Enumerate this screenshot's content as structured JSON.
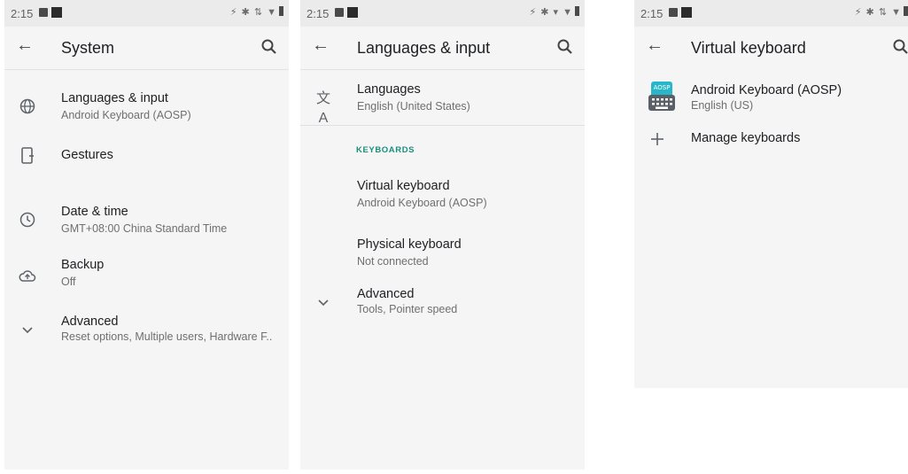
{
  "statusbar": {
    "time": "2:15"
  },
  "screen1": {
    "title": "System",
    "items": [
      {
        "icon": "globe-icon",
        "title": "Languages & input",
        "subtitle": "Android Keyboard (AOSP)"
      },
      {
        "icon": "gestures-icon",
        "title": "Gestures",
        "subtitle": ""
      },
      {
        "icon": "clock-icon",
        "title": "Date & time",
        "subtitle": "GMT+08:00 China Standard Time"
      },
      {
        "icon": "cloud-backup-icon",
        "title": "Backup",
        "subtitle": "Off"
      },
      {
        "icon": "chevron-down-icon",
        "title": "Advanced",
        "subtitle": "Reset options, Multiple users, Hardware F.."
      }
    ]
  },
  "screen2": {
    "title": "Languages & input",
    "languages": {
      "icon": "translate-icon",
      "title": "Languages",
      "subtitle": "English (United States)"
    },
    "section_header": "KEYBOARDS",
    "items": [
      {
        "title": "Virtual keyboard",
        "subtitle": "Android Keyboard (AOSP)"
      },
      {
        "title": "Physical keyboard",
        "subtitle": "Not connected"
      },
      {
        "icon": "chevron-down-icon",
        "title": "Advanced",
        "subtitle": "Tools, Pointer speed"
      }
    ]
  },
  "screen3": {
    "title": "Virtual keyboard",
    "keyboard": {
      "icon": "aosp-keyboard-icon",
      "icon_text": "AOSP",
      "title": "Android Keyboard (AOSP)",
      "subtitle": "English (US)"
    },
    "manage": {
      "icon": "plus-icon",
      "title": "Manage keyboards"
    }
  },
  "colors": {
    "accent": "#1a8f7a",
    "background": "#f5f5f5",
    "statusbar": "#ebebeb"
  }
}
